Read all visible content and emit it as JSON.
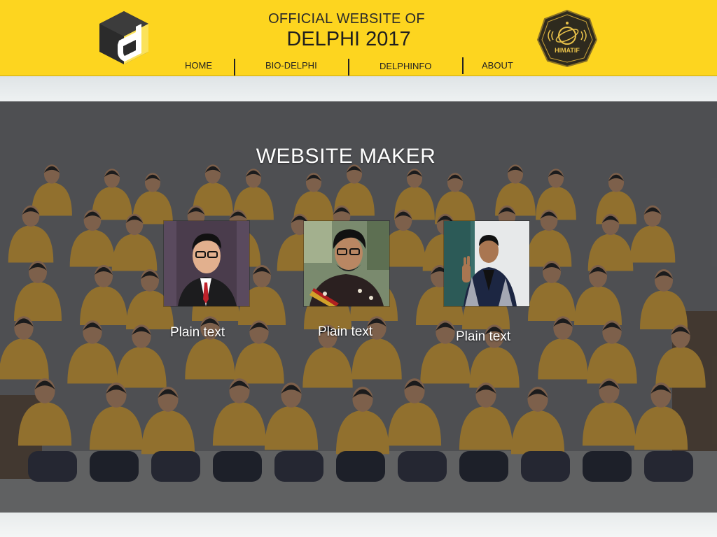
{
  "header": {
    "title_line1": "OFFICIAL WEBSITE OF",
    "title_line2": "DELPHI 2017",
    "logo_icon": "delphi-d-logo-icon",
    "badge_icon": "himatif-badge-icon",
    "badge_text": "HIMATIF"
  },
  "nav": {
    "items": [
      {
        "label": "HOME"
      },
      {
        "label": "BIO-DELPHI"
      },
      {
        "label": "DELPHINFO"
      },
      {
        "label": "ABOUT"
      }
    ]
  },
  "main": {
    "title": "WEBSITE MAKER",
    "members": [
      {
        "caption": "Plain text",
        "photo": "member-photo-suit"
      },
      {
        "caption": "Plain text",
        "photo": "member-photo-glasses"
      },
      {
        "caption": "Plain text",
        "photo": "member-photo-plaid"
      }
    ]
  },
  "colors": {
    "header_bg": "#fdd51f",
    "jacket": "#d9a338",
    "text_dark": "#222222",
    "text_light": "#ffffff"
  }
}
